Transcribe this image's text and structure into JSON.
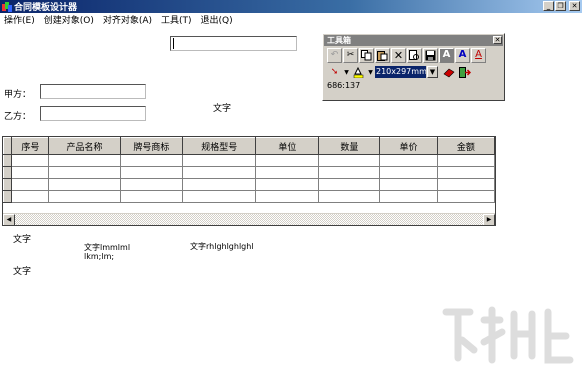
{
  "window": {
    "title": "合同模板设计器",
    "buttons": {
      "minimize": "_",
      "restore": "❐",
      "close": "✕"
    }
  },
  "menu": [
    "操作(E)",
    "创建对象(O)",
    "对齐对象(A)",
    "工具(T)",
    "退出(Q)"
  ],
  "form": {
    "party_a_label": "甲方：",
    "party_b_label": "乙方：",
    "text_label_1": "文字",
    "party_a_value": "",
    "party_b_value": "",
    "top_field_value": ""
  },
  "toolbox": {
    "title": "工具箱",
    "close": "✕",
    "paper_size": "210x297mm",
    "coordinates": "686:137",
    "icons": [
      "undo-icon",
      "cut-icon",
      "copy-icon",
      "paste-icon",
      "delete-icon",
      "preview-icon",
      "save-icon",
      "bold-a-icon",
      "font-a-icon",
      "text-color-icon",
      "pointer-icon",
      "fill-color-icon",
      "eraser-icon",
      "exit-icon"
    ]
  },
  "grid": {
    "columns": [
      "序号",
      "产品名称",
      "牌号商标",
      "规格型号",
      "单位",
      "数量",
      "单价",
      "金额"
    ],
    "row_count": 4
  },
  "canvas_texts": {
    "text_a": "文字",
    "text_b": "文字lmmlml",
    "text_b2": "lkm;lm;",
    "text_c": "文字rhlghlghlghl",
    "text_d": "文字"
  },
  "colors": {
    "title_gradient_start": "#0a246a",
    "title_gradient_end": "#a6caf0",
    "panel": "#d4d0c8",
    "selection": "#0a246a"
  }
}
